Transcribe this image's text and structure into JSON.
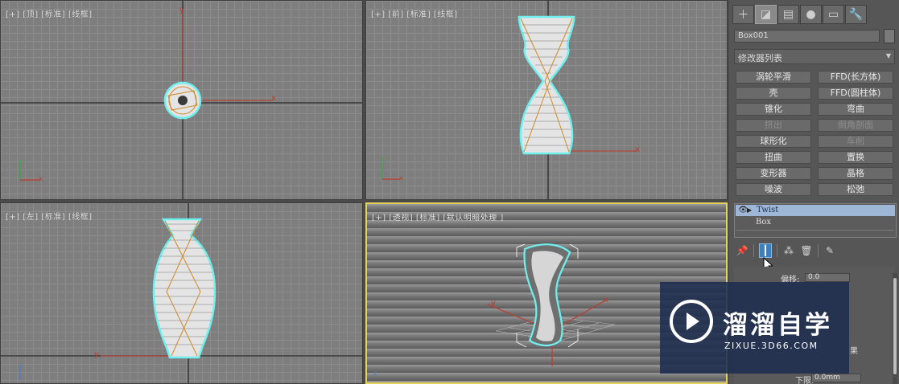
{
  "viewports": {
    "top": {
      "label": "[+] [顶] [标准] [线框]"
    },
    "front": {
      "label": "[+] [前] [标准] [线框]"
    },
    "left": {
      "label": "[+] [左] [标准] [线框]"
    },
    "perspective": {
      "label": "[+] [透视] [标准] [默认明暗处理 ]"
    }
  },
  "axis": {
    "x": "x",
    "y": "y",
    "z": "z"
  },
  "panel": {
    "tabs": [
      {
        "name": "create-tab",
        "glyph": "＋"
      },
      {
        "name": "modify-tab",
        "glyph": "◪"
      },
      {
        "name": "hierarchy-tab",
        "glyph": "▤"
      },
      {
        "name": "motion-tab",
        "glyph": "●"
      },
      {
        "name": "display-tab",
        "glyph": "▭"
      },
      {
        "name": "utilities-tab",
        "glyph": "🔧"
      }
    ],
    "object_name": "Box001",
    "modifier_list": "修改器列表",
    "modifiers": [
      {
        "label": "涡轮平滑",
        "enabled": true
      },
      {
        "label": "FFD(长方体)",
        "enabled": true
      },
      {
        "label": "壳",
        "enabled": true
      },
      {
        "label": "FFD(圆柱体)",
        "enabled": true
      },
      {
        "label": "锥化",
        "enabled": true
      },
      {
        "label": "弯曲",
        "enabled": true
      },
      {
        "label": "挤出",
        "enabled": false
      },
      {
        "label": "倒角剖面",
        "enabled": false
      },
      {
        "label": "球形化",
        "enabled": true
      },
      {
        "label": "车削",
        "enabled": false
      },
      {
        "label": "扭曲",
        "enabled": true
      },
      {
        "label": "置换",
        "enabled": true
      },
      {
        "label": "变形器",
        "enabled": true
      },
      {
        "label": "晶格",
        "enabled": true
      },
      {
        "label": "噪波",
        "enabled": true
      },
      {
        "label": "松弛",
        "enabled": true
      }
    ],
    "stack": [
      {
        "label": "Twist",
        "selected": true
      },
      {
        "label": "Box",
        "selected": false
      }
    ],
    "params": {
      "bias_label": "偏移:",
      "bias_value": "0.0",
      "effect_suffix": "果",
      "lower_label": "下限:",
      "lower_value": "0.0mm"
    }
  },
  "watermark": {
    "title": "溜溜自学",
    "subtitle": "ZIXUE.3D66.COM"
  }
}
